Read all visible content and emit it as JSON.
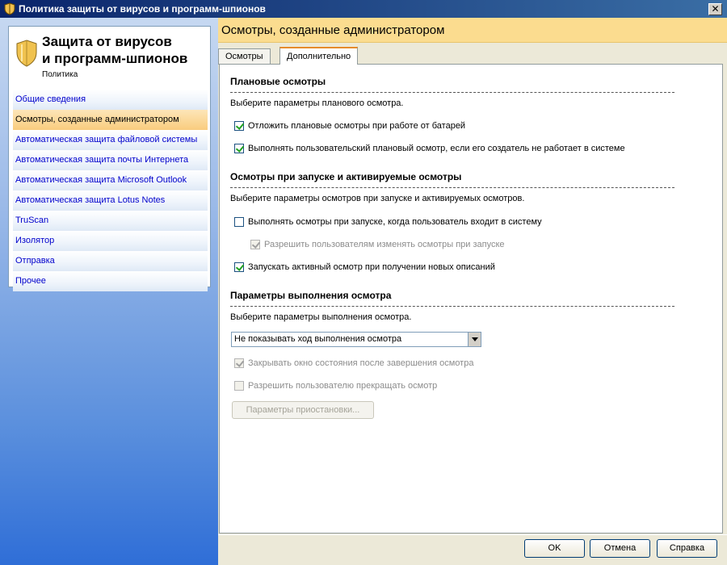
{
  "window": {
    "title": "Политика защиты от вирусов и программ-шпионов",
    "close_label": "✕"
  },
  "sidebar": {
    "brand_title_line1": "Защита от вирусов",
    "brand_title_line2": "и программ-шпионов",
    "brand_subtitle": "Политика",
    "items": [
      {
        "label": "Общие сведения"
      },
      {
        "label": "Осмотры, созданные администратором"
      },
      {
        "label": "Автоматическая защита файловой системы"
      },
      {
        "label": "Автоматическая защита почты Интернета"
      },
      {
        "label": "Автоматическая защита Microsoft Outlook"
      },
      {
        "label": "Автоматическая защита Lotus Notes"
      },
      {
        "label": "TruScan"
      },
      {
        "label": "Изолятор"
      },
      {
        "label": "Отправка"
      },
      {
        "label": "Прочее"
      }
    ],
    "active_index": 1
  },
  "main": {
    "header": "Осмотры, созданные администратором",
    "tabs": [
      "Осмотры",
      "Дополнительно"
    ],
    "active_tab": 1,
    "sections": {
      "scheduled": {
        "title": "Плановые осмотры",
        "desc": "Выберите параметры планового осмотра.",
        "cb1": "Отложить плановые осмотры при работе от батарей",
        "cb2": "Выполнять пользовательский плановый осмотр, если его создатель не работает в системе"
      },
      "startup": {
        "title": "Осмотры при запуске и активируемые осмотры",
        "desc": "Выберите параметры осмотров при запуске и активируемых осмотров.",
        "cb1": "Выполнять осмотры при запуске, когда пользователь входит в систему",
        "cb2": "Разрешить пользователям изменять осмотры при запуске",
        "cb3": "Запускать активный осмотр при получении новых описаний"
      },
      "execution": {
        "title": "Параметры выполнения осмотра",
        "desc": "Выберите параметры выполнения осмотра.",
        "progress_select": "Не показывать ход выполнения осмотра",
        "cb1": "Закрывать окно состояния после завершения осмотра",
        "cb2": "Разрешить пользователю прекращать осмотр",
        "pause_button": "Параметры приостановки..."
      }
    }
  },
  "footer": {
    "ok": "OK",
    "cancel": "Отмена",
    "help": "Справка"
  },
  "colors": {
    "header_bg": "#fbdc8f",
    "active_nav": "#f9cc7e",
    "link": "#0000cc"
  }
}
